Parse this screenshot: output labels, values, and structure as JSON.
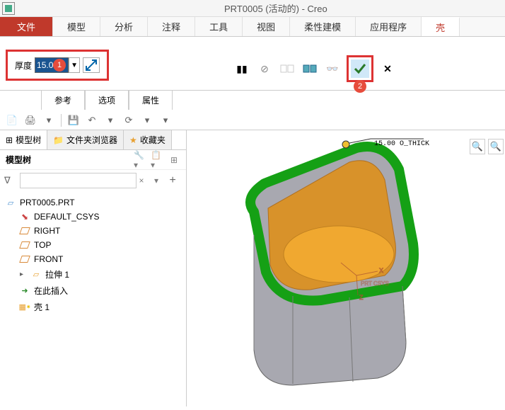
{
  "title": "PRT0005 (活动的) - Creo",
  "ribbon": {
    "tabs": [
      "文件",
      "模型",
      "分析",
      "注释",
      "工具",
      "视图",
      "柔性建模",
      "应用程序",
      "壳"
    ],
    "active_tab": "壳"
  },
  "thickness": {
    "label": "厚度",
    "value": "15.00",
    "badge1": "1"
  },
  "actions": {
    "check_badge": "2"
  },
  "sub_tabs": [
    "参考",
    "选项",
    "属性"
  ],
  "sidebar": {
    "tabs": {
      "model_tree": "模型树",
      "folder": "文件夹浏览器",
      "favorites": "收藏夹"
    },
    "tree_title": "模型树",
    "items": {
      "prt": "PRT0005.PRT",
      "csys": "DEFAULT_CSYS",
      "right": "RIGHT",
      "top": "TOP",
      "front": "FRONT",
      "extrude": "拉伸 1",
      "insert": "在此插入",
      "shell": "壳 1"
    }
  },
  "viewport": {
    "dim_label": "15.00 O_THICK"
  }
}
